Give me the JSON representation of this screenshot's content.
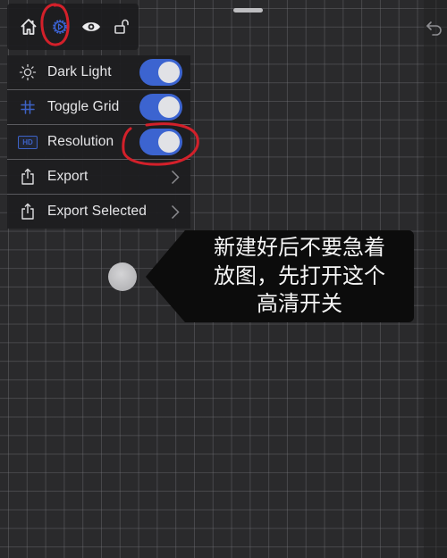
{
  "toolbar": {
    "buttons": [
      {
        "name": "home-icon",
        "active": false
      },
      {
        "name": "settings-gear-icon",
        "active": true
      },
      {
        "name": "eye-icon",
        "active": false
      },
      {
        "name": "unlock-icon",
        "active": false
      }
    ]
  },
  "top_right": {
    "undo": "undo-icon"
  },
  "settings_menu": {
    "items": [
      {
        "label": "Dark Light",
        "icon": "sun-icon",
        "control": "toggle",
        "on": true
      },
      {
        "label": "Toggle Grid",
        "icon": "grid-hash-icon",
        "control": "toggle",
        "on": true
      },
      {
        "label": "Resolution",
        "icon": "hd-icon",
        "icon_text": "HD",
        "control": "toggle",
        "on": true
      },
      {
        "label": "Export",
        "icon": "share-icon",
        "control": "chevron"
      },
      {
        "label": "Export Selected",
        "icon": "share-icon",
        "control": "chevron"
      }
    ]
  },
  "canvas": {
    "node": "gray-circle-node"
  },
  "annotation": {
    "callout_lines": [
      "新建好后不要急着",
      "放图，先打开这个",
      "高清开关"
    ],
    "highlight_color": "#d3202a"
  },
  "colors": {
    "accent": "#3c64d0",
    "canvas_bg": "#2a2a2c",
    "panel_bg": "#1e1e20"
  }
}
